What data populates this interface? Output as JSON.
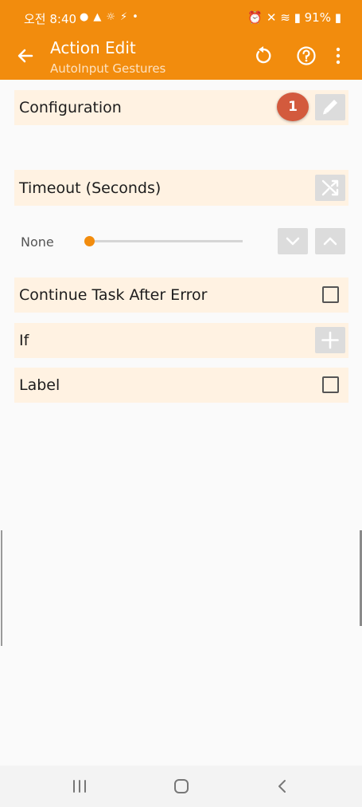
{
  "statusbar": {
    "time": "오전 8:40",
    "battery": "91%"
  },
  "appbar": {
    "title": "Action Edit",
    "subtitle": "AutoInput Gestures"
  },
  "rows": {
    "configuration": {
      "label": "Configuration",
      "badge": "1"
    },
    "timeout": {
      "label": "Timeout (Seconds)"
    },
    "timeout_value": {
      "label": "None",
      "level": 0
    },
    "continue": {
      "label": "Continue Task After Error",
      "checked": false
    },
    "if": {
      "label": "If"
    },
    "label": {
      "label": "Label",
      "checked": false
    }
  },
  "colors": {
    "accent": "#f28c0d",
    "row_bg": "#fff2e2",
    "badge": "#d35a3d"
  }
}
